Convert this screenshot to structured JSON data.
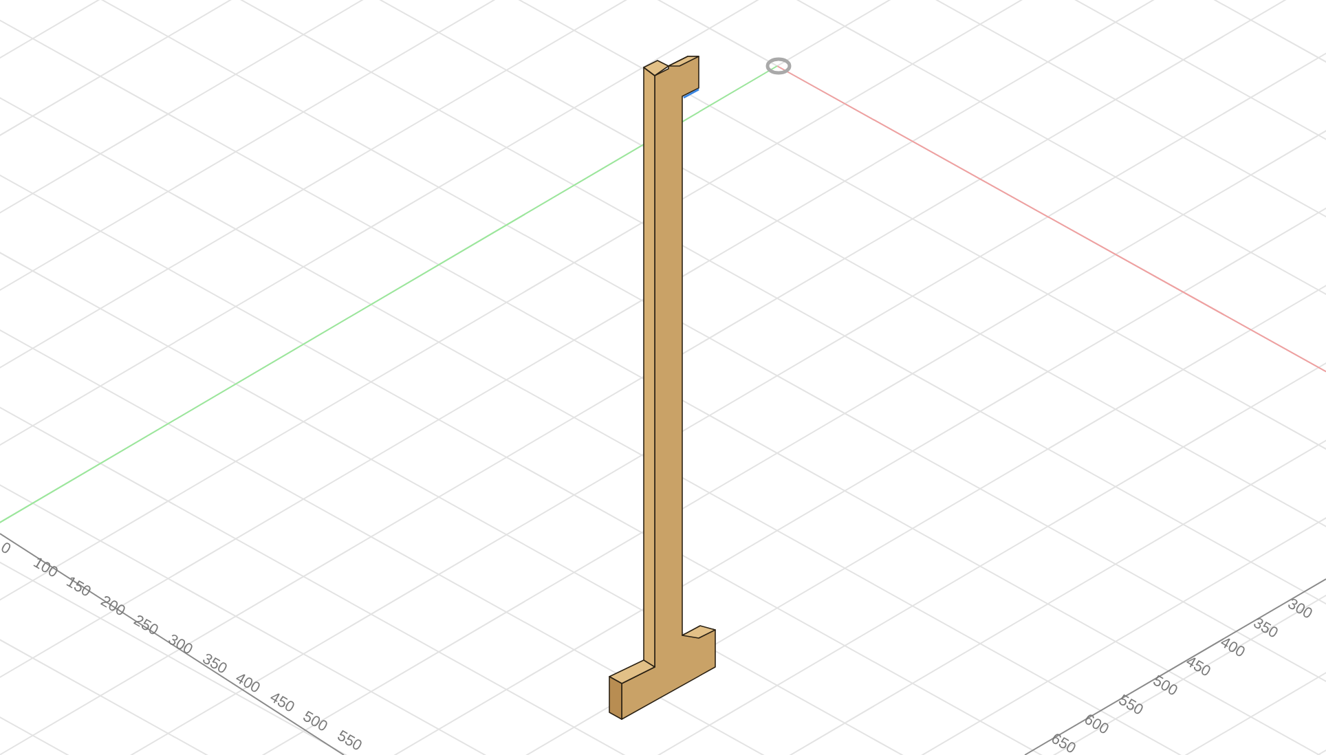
{
  "viewport": {
    "left_ruler_labels": [
      "0",
      "100",
      "150",
      "200",
      "250",
      "300",
      "350",
      "400",
      "450",
      "500",
      "550"
    ],
    "right_ruler_labels": [
      "300",
      "350",
      "400",
      "450",
      "500",
      "550",
      "600",
      "650"
    ]
  }
}
